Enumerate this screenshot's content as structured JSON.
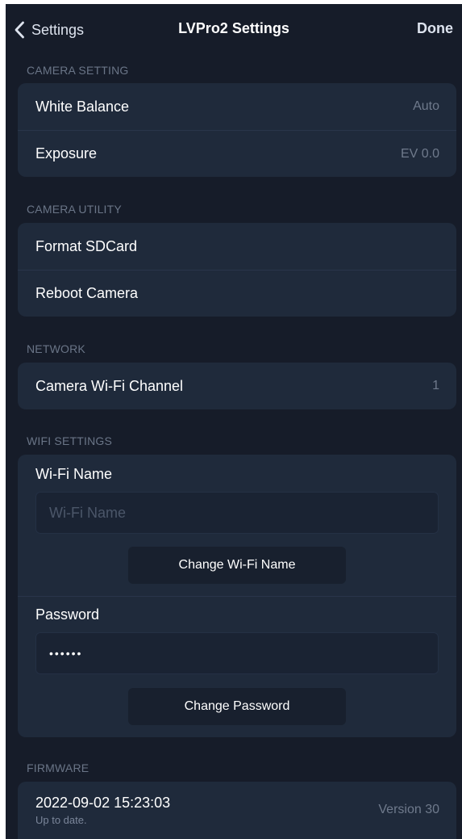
{
  "nav": {
    "back_label": "Settings",
    "title": "LVPro2 Settings",
    "done_label": "Done"
  },
  "camera_setting": {
    "header": "CAMERA SETTING",
    "rows": [
      {
        "label": "White Balance",
        "value": "Auto"
      },
      {
        "label": "Exposure",
        "value": "EV 0.0"
      }
    ]
  },
  "camera_utility": {
    "header": "CAMERA UTILITY",
    "rows": [
      {
        "label": "Format SDCard"
      },
      {
        "label": "Reboot Camera"
      }
    ]
  },
  "network": {
    "header": "NETWORK",
    "rows": [
      {
        "label": "Camera Wi-Fi Channel",
        "value": "1"
      }
    ]
  },
  "wifi_settings": {
    "header": "WIFI SETTINGS",
    "name_label": "Wi-Fi Name",
    "name_placeholder": "Wi-Fi Name",
    "name_button": "Change Wi-Fi Name",
    "password_label": "Password",
    "password_value": "••••••",
    "password_button": "Change Password"
  },
  "firmware": {
    "header": "FIRMWARE",
    "date": "2022-09-02 15:23:03",
    "status": "Up to date.",
    "version": "Version 30"
  },
  "colors": {
    "background": "#161c29",
    "group": "#1f2a3b",
    "header_text": "#6a7587",
    "secondary_text": "#6f7a8c"
  }
}
